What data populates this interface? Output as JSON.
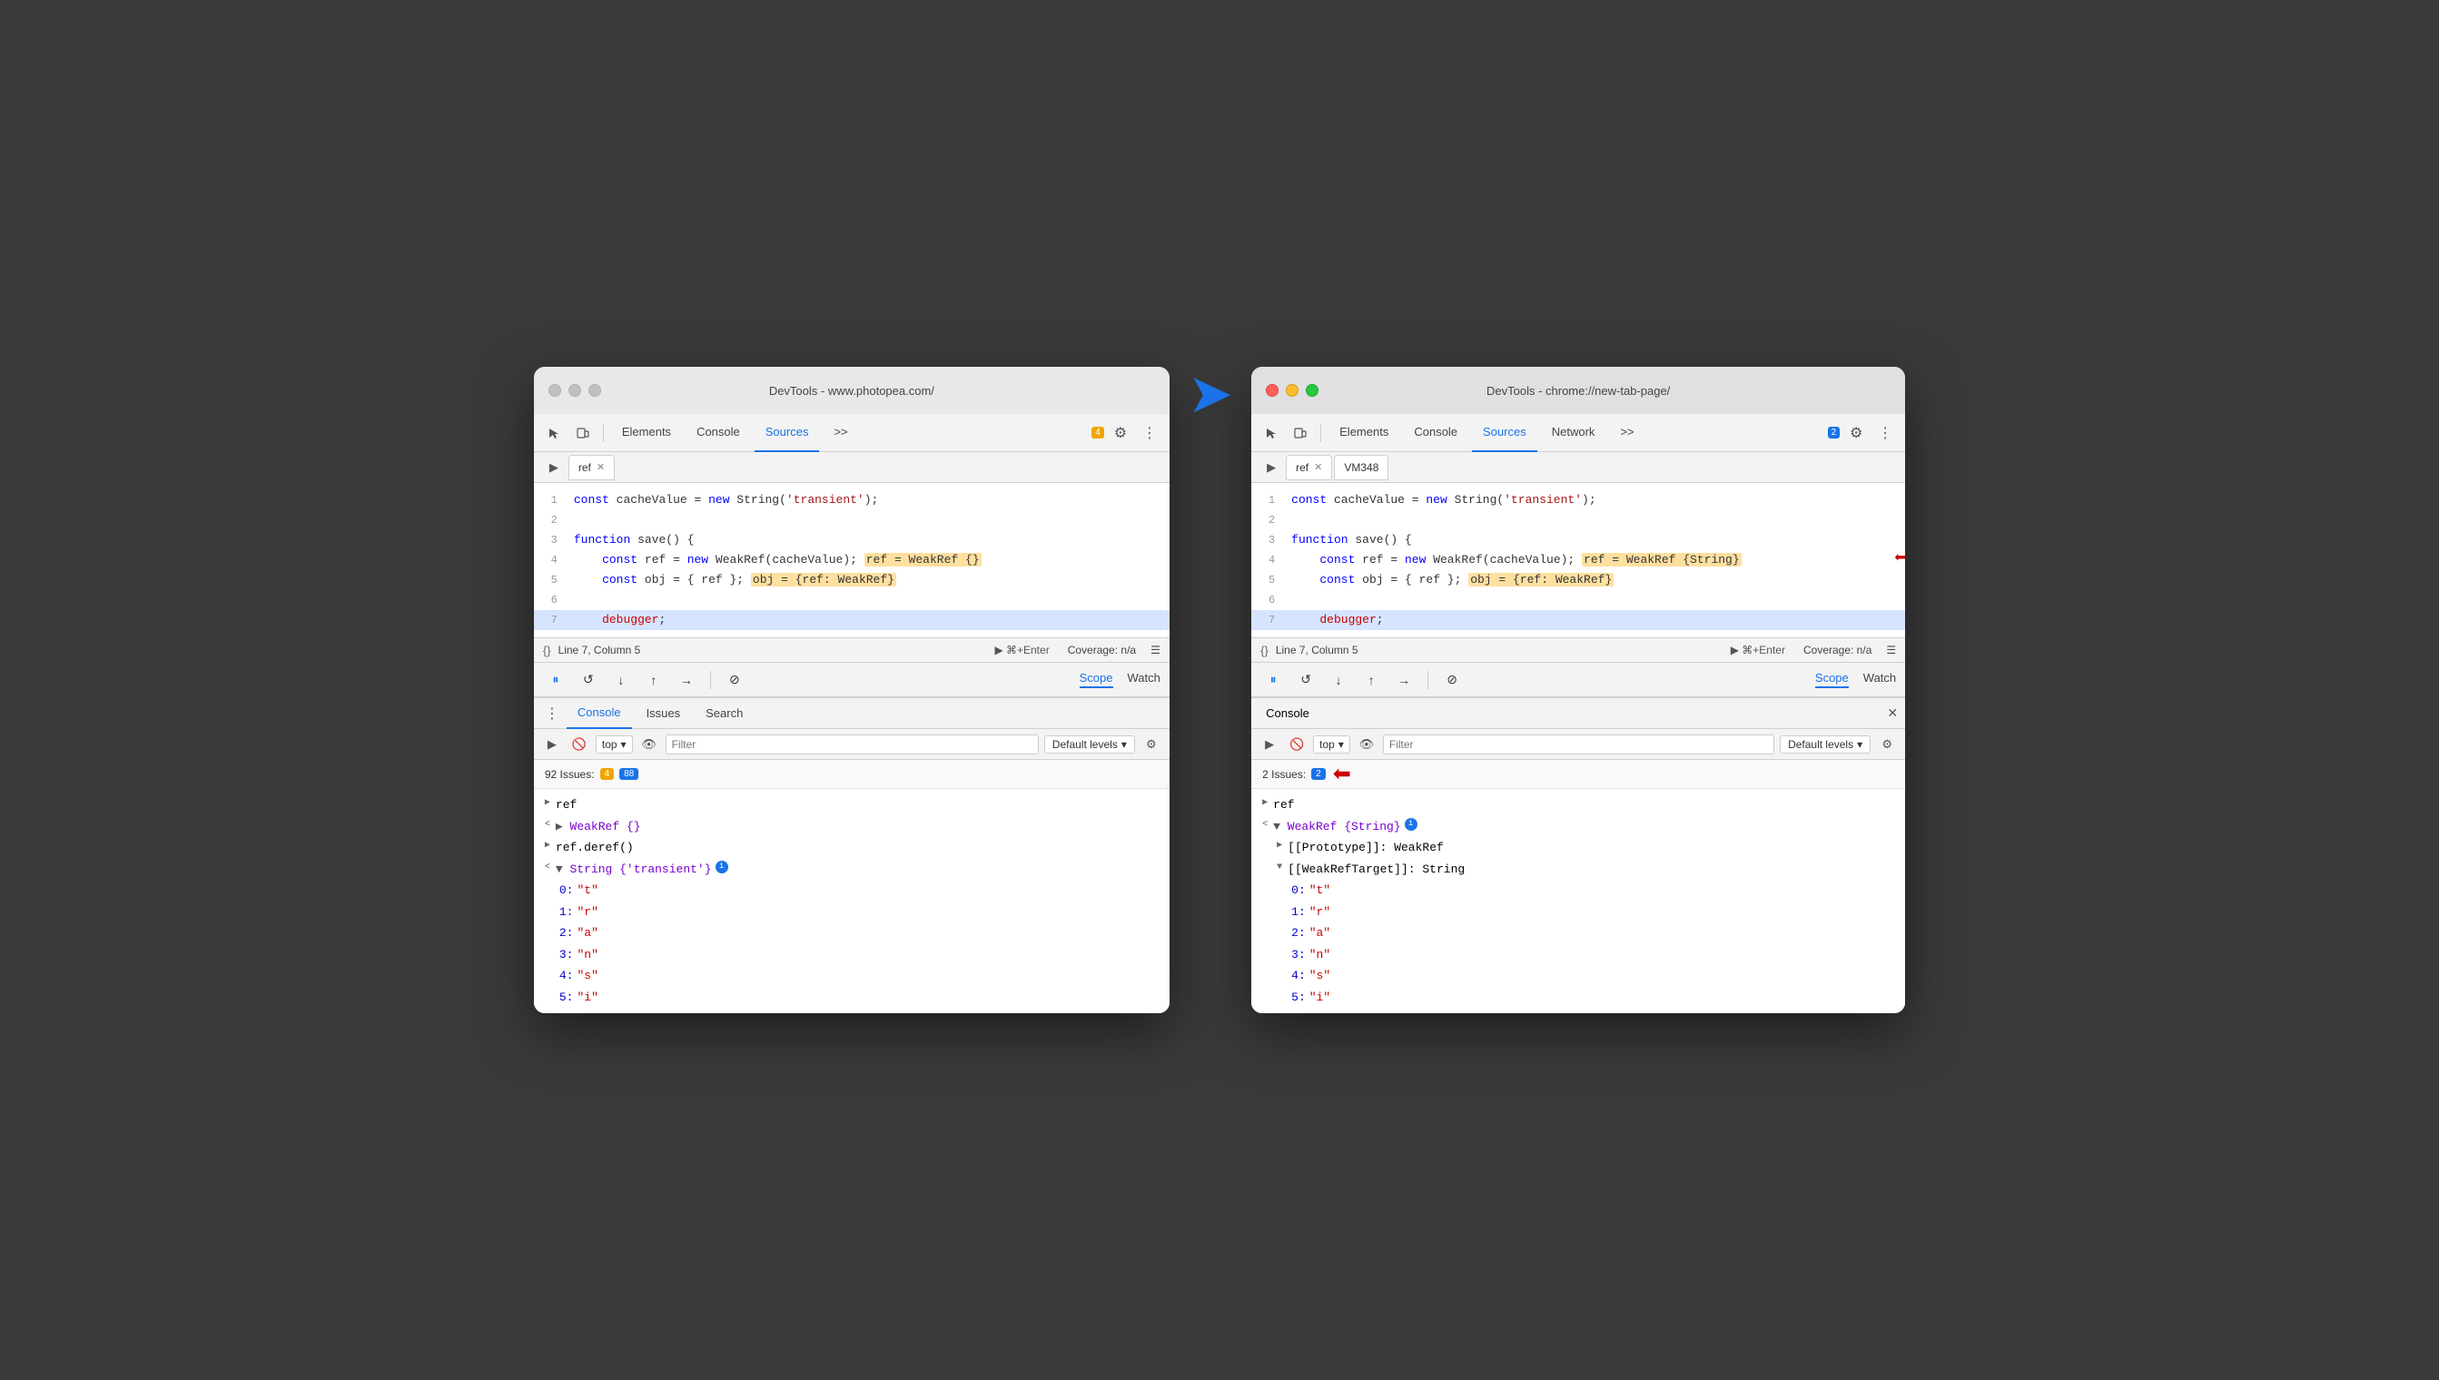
{
  "left_window": {
    "title": "DevTools - www.photopea.com/",
    "tabs": [
      "Elements",
      "Console",
      "Sources",
      ">>"
    ],
    "active_tab": "Sources",
    "badge": "4",
    "file_tabs": [
      "ref"
    ],
    "code_lines": [
      {
        "num": 1,
        "content": "const cacheValue = new String('transient');",
        "highlighted": false
      },
      {
        "num": 2,
        "content": "",
        "highlighted": false
      },
      {
        "num": 3,
        "content": "function save() {",
        "highlighted": false
      },
      {
        "num": 4,
        "content": "    const ref = new WeakRef(cacheValue);  ref = WeakRef {}",
        "highlighted": false,
        "has_inline": true,
        "inline_text": "ref = WeakRef {}"
      },
      {
        "num": 5,
        "content": "    const obj = { ref };  obj = {ref: WeakRef}",
        "highlighted": false,
        "has_inline2": true,
        "inline_text2": "obj = {ref: WeakRef}"
      },
      {
        "num": 6,
        "content": "",
        "highlighted": false
      },
      {
        "num": 7,
        "content": "    debugger;",
        "highlighted": true
      }
    ],
    "status": "Line 7, Column 5",
    "coverage": "Coverage: n/a",
    "scope_tabs": [
      "Scope",
      "Watch"
    ],
    "active_scope_tab": "Scope",
    "bottom_tabs": [
      "Console",
      "Issues",
      "Search"
    ],
    "active_bottom_tab": "Console",
    "issues_count": "92 Issues:",
    "issues_warn": "4",
    "issues_info": "88",
    "console_items": [
      {
        "indent": 0,
        "arrow": ">",
        "text": "ref"
      },
      {
        "indent": 0,
        "arrow": "<",
        "text": "▶ WeakRef {}",
        "purple": true
      },
      {
        "indent": 0,
        "arrow": ">",
        "text": "ref.deref()"
      },
      {
        "indent": 0,
        "arrow": "<",
        "text": "▼ String {'transient'}",
        "has_info": true
      },
      {
        "indent": 1,
        "arrow": "",
        "text": "0: \"t\""
      },
      {
        "indent": 1,
        "arrow": "",
        "text": "1: \"r\""
      },
      {
        "indent": 1,
        "arrow": "",
        "text": "2: \"a\""
      },
      {
        "indent": 1,
        "arrow": "",
        "text": "3: \"n\""
      },
      {
        "indent": 1,
        "arrow": "",
        "text": "4: \"s\""
      },
      {
        "indent": 1,
        "arrow": "",
        "text": "5: \"i\""
      }
    ]
  },
  "right_window": {
    "title": "DevTools - chrome://new-tab-page/",
    "tabs": [
      "Elements",
      "Console",
      "Sources",
      "Network",
      ">>"
    ],
    "active_tab": "Sources",
    "badge": "2",
    "file_tabs": [
      "ref",
      "VM348"
    ],
    "code_lines": [
      {
        "num": 1,
        "content": "const cacheValue = new String('transient');",
        "highlighted": false
      },
      {
        "num": 2,
        "content": "",
        "highlighted": false
      },
      {
        "num": 3,
        "content": "function save() {",
        "highlighted": false
      },
      {
        "num": 4,
        "content": "    const ref = new WeakRef(cacheValue);  ref = WeakRef {String}",
        "highlighted": false,
        "has_inline": true,
        "inline_text": "ref = WeakRef {String}",
        "has_red_arrow": true
      },
      {
        "num": 5,
        "content": "    const obj = { ref };  obj = {ref: WeakRef}",
        "highlighted": false,
        "has_inline2": true,
        "inline_text2": "obj = {ref: WeakRef}"
      },
      {
        "num": 6,
        "content": "",
        "highlighted": false
      },
      {
        "num": 7,
        "content": "    debugger;",
        "highlighted": true
      }
    ],
    "status": "Line 7, Column 5",
    "coverage": "Coverage: n/a",
    "scope_tabs": [
      "Scope",
      "Watch"
    ],
    "active_scope_tab": "Scope",
    "console_title": "Console",
    "issues_count": "2 Issues:",
    "issues_info": "2",
    "console_items": [
      {
        "indent": 0,
        "arrow": ">",
        "text": "ref"
      },
      {
        "indent": 0,
        "arrow": "<",
        "text": "▼ WeakRef {String}",
        "purple": true,
        "has_info": true,
        "has_red_arrow_below": true
      },
      {
        "indent": 1,
        "arrow": "▶",
        "text": "[[Prototype]]: WeakRef"
      },
      {
        "indent": 1,
        "arrow": "▼",
        "text": "[[WeakRefTarget]]: String"
      },
      {
        "indent": 2,
        "arrow": "",
        "text": "0: \"t\""
      },
      {
        "indent": 2,
        "arrow": "",
        "text": "1: \"r\""
      },
      {
        "indent": 2,
        "arrow": "",
        "text": "2: \"a\""
      },
      {
        "indent": 2,
        "arrow": "",
        "text": "3: \"n\""
      },
      {
        "indent": 2,
        "arrow": "",
        "text": "4: \"s\""
      },
      {
        "indent": 2,
        "arrow": "",
        "text": "5: \"i\""
      }
    ]
  },
  "labels": {
    "elements": "Elements",
    "console": "Console",
    "sources": "Sources",
    "network": "Network",
    "more": ">>",
    "ref": "ref",
    "vm348": "VM348",
    "scope": "Scope",
    "watch": "Watch",
    "issues": "Issues",
    "search": "Search",
    "filter": "Filter",
    "default_levels": "Default levels",
    "top": "top",
    "coverage_na": "Coverage: n/a",
    "line7col5": "Line 7, Column 5",
    "issues_label": "Issues:",
    "close": "✕"
  }
}
